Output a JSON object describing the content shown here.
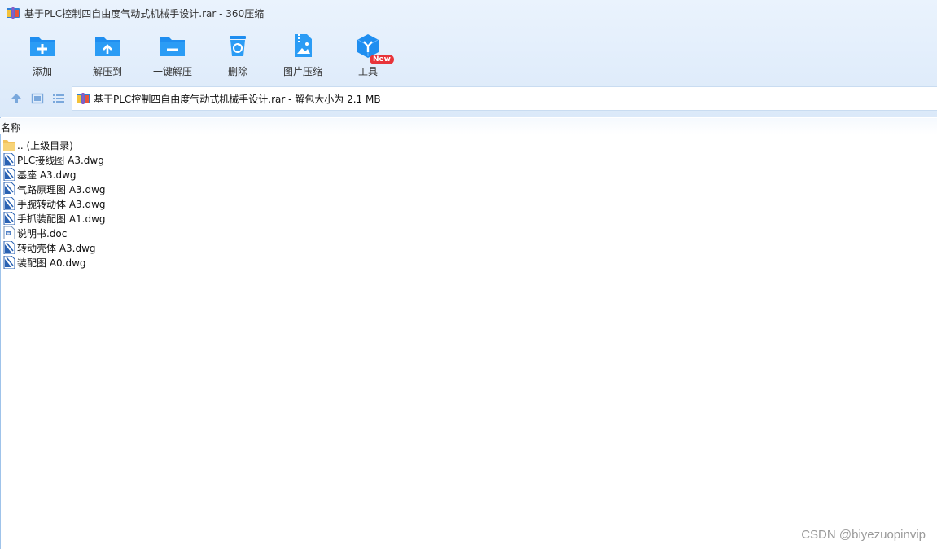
{
  "window": {
    "title": "基于PLC控制四自由度气动式机械手设计.rar - 360压缩"
  },
  "toolbar": {
    "items": [
      {
        "label": "添加",
        "icon": "folder-add-icon"
      },
      {
        "label": "解压到",
        "icon": "folder-extract-icon"
      },
      {
        "label": "一键解压",
        "icon": "folder-oneclick-icon"
      },
      {
        "label": "删除",
        "icon": "recycle-bin-icon"
      },
      {
        "label": "图片压缩",
        "icon": "image-compress-icon"
      },
      {
        "label": "工具",
        "icon": "tools-cube-icon"
      }
    ],
    "badge": "New"
  },
  "nav": {
    "path": "基于PLC控制四自由度气动式机械手设计.rar - 解包大小为 2.1 MB"
  },
  "list": {
    "column_name": "名称",
    "files": [
      {
        "name": ".. (上级目录)",
        "type": "folder"
      },
      {
        "name": "PLC接线图 A3.dwg",
        "type": "dwg"
      },
      {
        "name": "基座 A3.dwg",
        "type": "dwg"
      },
      {
        "name": "气路原理图 A3.dwg",
        "type": "dwg"
      },
      {
        "name": "手腕转动体 A3.dwg",
        "type": "dwg"
      },
      {
        "name": "手抓装配图 A1.dwg",
        "type": "dwg"
      },
      {
        "name": "说明书.doc",
        "type": "doc"
      },
      {
        "name": "转动壳体 A3.dwg",
        "type": "dwg"
      },
      {
        "name": "装配图 A0.dwg",
        "type": "dwg"
      }
    ]
  },
  "watermark": "CSDN @biyezuopinvip",
  "colors": {
    "accent": "#1f8ef0",
    "badge": "#e8343a"
  }
}
